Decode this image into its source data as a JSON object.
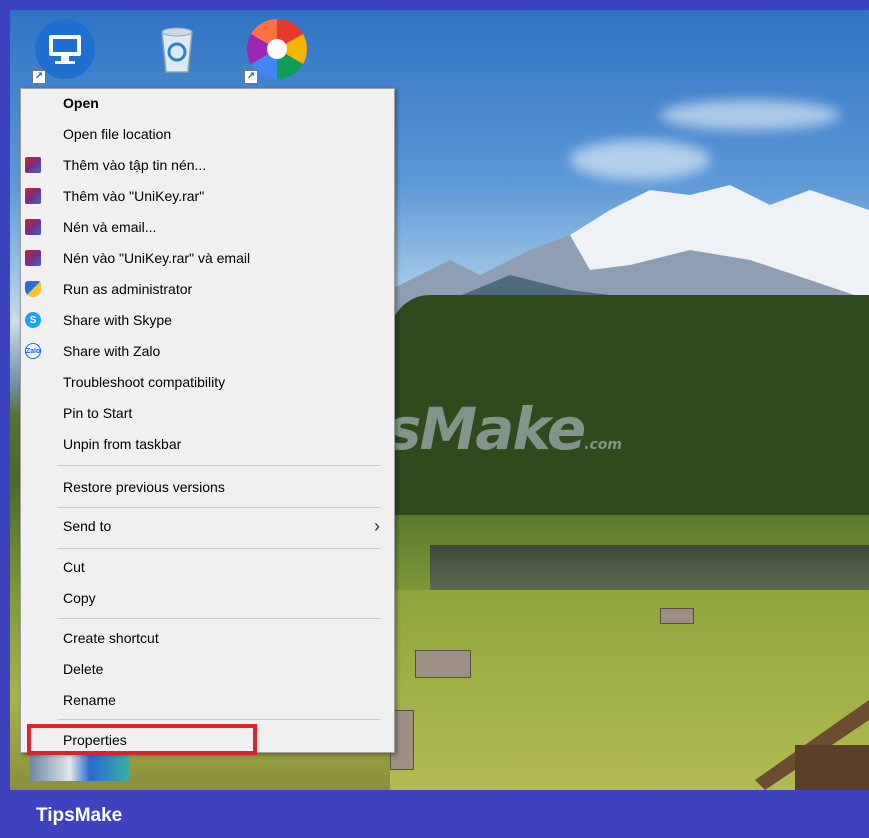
{
  "desktop": {
    "icons": [
      "monitor-icon",
      "recycle-bin-icon",
      "picasa-icon"
    ],
    "watermark": "TipsMake",
    "watermark_suffix": ".com"
  },
  "menu": {
    "items": [
      {
        "label": "Open",
        "icon": null,
        "bold": true
      },
      {
        "label": "Open file location",
        "icon": null
      },
      {
        "label": "Thêm vào tập tin nén...",
        "icon": "winrar-icon"
      },
      {
        "label": "Thêm vào \"UniKey.rar\"",
        "icon": "winrar-icon"
      },
      {
        "label": "Nén và email...",
        "icon": "winrar-icon"
      },
      {
        "label": "Nén vào \"UniKey.rar\" và email",
        "icon": "winrar-icon"
      },
      {
        "label": "Run as administrator",
        "icon": "uac-shield-icon"
      },
      {
        "label": "Share with Skype",
        "icon": "skype-icon"
      },
      {
        "label": "Share with Zalo",
        "icon": "zalo-icon"
      },
      {
        "label": "Troubleshoot compatibility",
        "icon": null
      },
      {
        "label": "Pin to Start",
        "icon": null
      },
      {
        "label": "Unpin from taskbar",
        "icon": null
      },
      {
        "label": "Restore previous versions",
        "icon": null
      },
      {
        "label": "Send to",
        "icon": null,
        "submenu": true
      },
      {
        "label": "Cut",
        "icon": null
      },
      {
        "label": "Copy",
        "icon": null
      },
      {
        "label": "Create shortcut",
        "icon": null
      },
      {
        "label": "Delete",
        "icon": null
      },
      {
        "label": "Rename",
        "icon": null
      },
      {
        "label": "Properties",
        "icon": null,
        "highlighted": true
      }
    ],
    "submenu_glyph": "›",
    "icon_glyphs": {
      "skype": "S",
      "zalo": "Zalo"
    }
  },
  "footer": {
    "label": "TipsMake"
  },
  "colors": {
    "frame": "#3d42bf",
    "highlight": "#d9232e",
    "menu_bg": "#f0f0f0"
  }
}
